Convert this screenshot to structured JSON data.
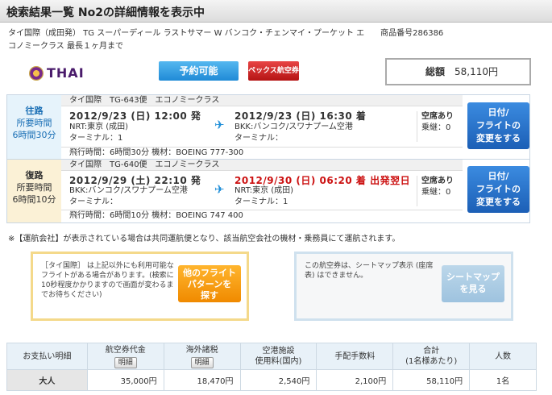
{
  "page": {
    "title": "検索結果一覧 No2の詳細情報を表示中",
    "desc_line1": "タイ国際（成田発） TG スーパーディール ラストサマー W バンコク・チェンマイ・プーケット エ　　商品番号286386",
    "desc_line2": "コノミークラス 最長１ヶ月まで"
  },
  "airline": {
    "logo_text": "THAI"
  },
  "buttons": {
    "available": "予約可能",
    "pex": "ペックス航空券",
    "change_line1": "日付/",
    "change_line2": "フライトの",
    "change_line3": "変更をする"
  },
  "total": {
    "label": "総額",
    "amount": "58,110円"
  },
  "outbound": {
    "label": "往路",
    "duration_label": "所要時間",
    "duration": "6時間30分",
    "header": "タイ国際　TG-643便　エコノミークラス",
    "dep_time": "2012/9/23 (日) 12:00 発",
    "dep_port": "NRT:東京 (成田)",
    "dep_terminal": "ターミナル：1",
    "arr_time": "2012/9/23 (日) 16:30 着",
    "arr_port": "BKK:バンコク/スワナプーム空港",
    "arr_terminal": "ターミナル：",
    "seat": "空席あり",
    "transfer": "乗継：0",
    "footer": "飛行時間：6時間30分 機材：BOEING 777-300"
  },
  "return": {
    "label": "復路",
    "duration_label": "所要時間",
    "duration": "6時間10分",
    "header": "タイ国際　TG-640便　エコノミークラス",
    "dep_time": "2012/9/29 (土) 22:10 発",
    "dep_port": "BKK:バンコク/スワナプーム空港",
    "dep_terminal": "ターミナル：",
    "arr_time": "2012/9/30 (日) 06:20 着 出発翌日",
    "arr_port": "NRT:東京 (成田)",
    "arr_terminal": "ターミナル：1",
    "seat": "空席あり",
    "transfer": "乗継：0",
    "footer": "飛行時間：6時間10分 機材：BOEING 747 400"
  },
  "note": "※【運航会社】が表示されている場合は共同運航便となり、該当航空会社の機材・乗務員にて運航されます。",
  "other_flights": {
    "text": "［タイ国際］ は上記以外にも利用可能なフライトがある場合があります。(検索に10秒程度かかりますので画面が変わるまでお待ちください)",
    "btn_line1": "他のフライト",
    "btn_line2": "パターンを",
    "btn_line3": "探す"
  },
  "seatmap": {
    "text": "この航空券は、シートマップ表示 (座席表) はできません。",
    "btn_line1": "シートマップ",
    "btn_line2": "を見る"
  },
  "price_table": {
    "headers": [
      "お支払い明細",
      "航空券代金",
      "海外諸税",
      "空港施設",
      "手配手数料",
      "合計",
      "人数"
    ],
    "header_sub": {
      "airport": "使用料(国内)",
      "total": "(1名様あたり)",
      "detail_btn": "明細"
    },
    "row": {
      "label": "大人",
      "fare": "35,000円",
      "tax": "18,470円",
      "airport": "2,540円",
      "fee": "2,100円",
      "total": "58,110円",
      "pax": "1名"
    }
  }
}
